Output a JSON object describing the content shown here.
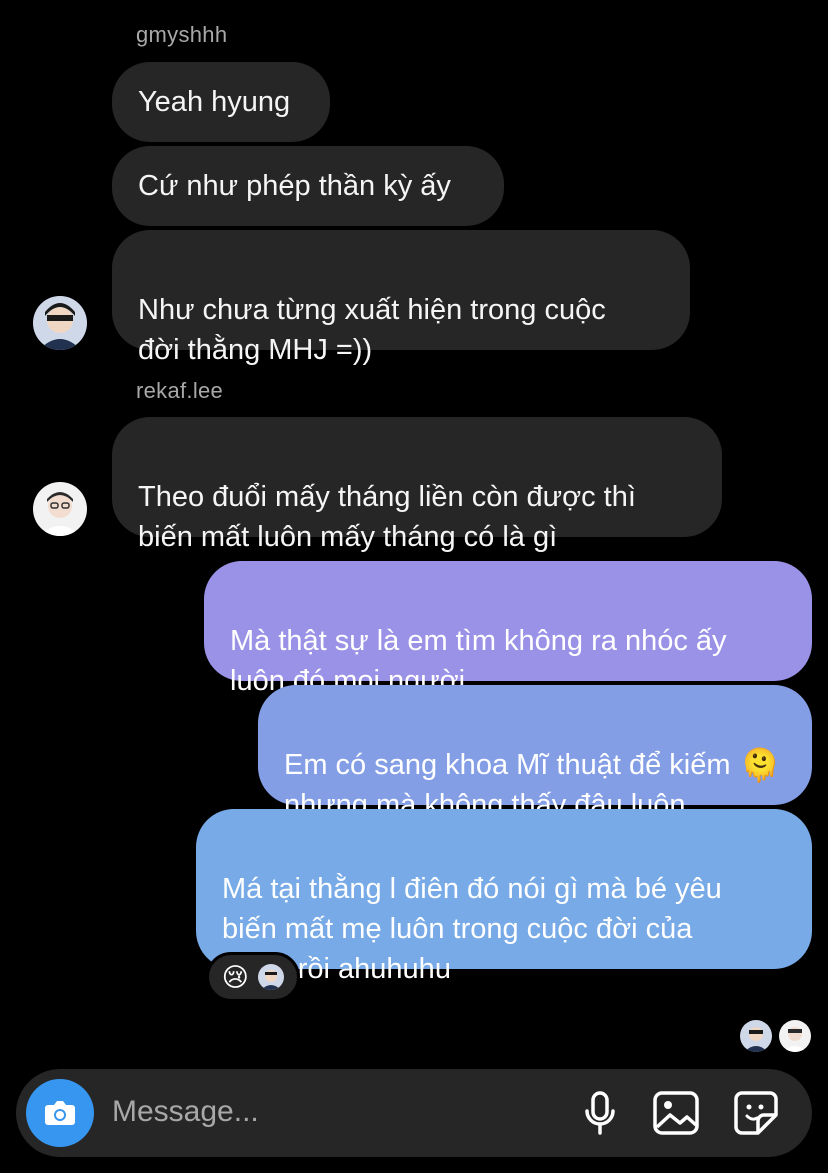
{
  "thread": {
    "groups": [
      {
        "username": "gmyshhh",
        "messages": [
          "Yeah hyung",
          "Cứ như phép thần kỳ ấy",
          "Như chưa từng xuất hiện trong cuộc\nđời thằng MHJ =))"
        ]
      },
      {
        "username": "rekaf.lee",
        "messages": [
          "Theo đuổi mấy tháng liền còn được thì\nbiến mất luôn mấy tháng có là gì"
        ]
      }
    ],
    "outgoing": [
      "Mà thật sự là em tìm không ra nhóc ấy\nluôn đó mọi người",
      "Em có sang khoa Mĩ thuật để kiếm\nnhưng mà không thấy đâu luôn",
      "Má tại thằng l điên đó nói gì mà bé yêu\nbiến mất mẹ luôn trong cuộc đời của\nKeria rồi ahuhuhu"
    ],
    "reaction_emoji": "😢",
    "inline_emoji": "🫠"
  },
  "composer": {
    "placeholder": "Message..."
  },
  "colors": {
    "incoming_bubble": "#262626",
    "outgoing_top": "#9c8ee8",
    "outgoing_bottom": "#74ace6",
    "camera_button": "#3797f0"
  }
}
